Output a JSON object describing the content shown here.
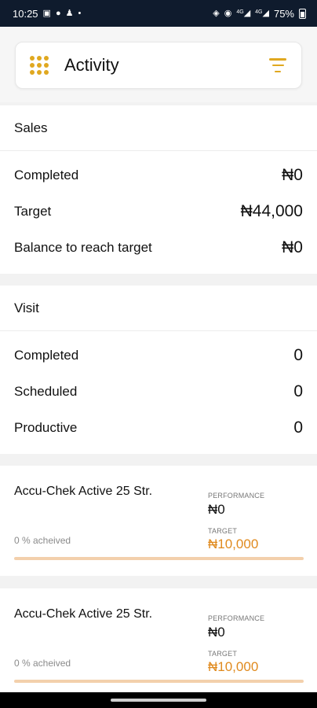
{
  "status_bar": {
    "time": "10:25",
    "left_icons": [
      "image-icon",
      "location-pin-icon",
      "person-icon",
      "dot-icon"
    ],
    "right_icons": [
      "vibrate-icon",
      "location-icon",
      "4g-signal-icon",
      "4g-signal-icon"
    ],
    "network_a": "4G",
    "network_b": "4G",
    "battery": "75%"
  },
  "app_bar": {
    "title": "Activity",
    "menu_icon": "grid-icon",
    "filter_icon": "filter-icon",
    "accent_color": "#e0a820"
  },
  "sales": {
    "title": "Sales",
    "rows": [
      {
        "label": "Completed",
        "value": "₦0"
      },
      {
        "label": "Target",
        "value": "₦44,000"
      },
      {
        "label": "Balance to reach target",
        "value": "₦0"
      }
    ]
  },
  "visit": {
    "title": "Visit",
    "rows": [
      {
        "label": "Completed",
        "value": "0"
      },
      {
        "label": "Scheduled",
        "value": "0"
      },
      {
        "label": "Productive",
        "value": "0"
      }
    ]
  },
  "products": [
    {
      "name": "Accu-Chek Active 25 Str.",
      "achieved": "0 % acheived",
      "performance_label": "PERFORMANCE",
      "performance_value": "₦0",
      "target_label": "TARGET",
      "target_value": "₦10,000",
      "progress": 0
    },
    {
      "name": "Accu-Chek Active 25 Str.",
      "achieved": "0 % acheived",
      "performance_label": "PERFORMANCE",
      "performance_value": "₦0",
      "target_label": "TARGET",
      "target_value": "₦10,000",
      "progress": 0
    }
  ],
  "colors": {
    "status_bar": "#0f1b2d",
    "accent": "#e0a820",
    "target_text": "#e08a1e",
    "progress_track": "#f3d0ac"
  }
}
